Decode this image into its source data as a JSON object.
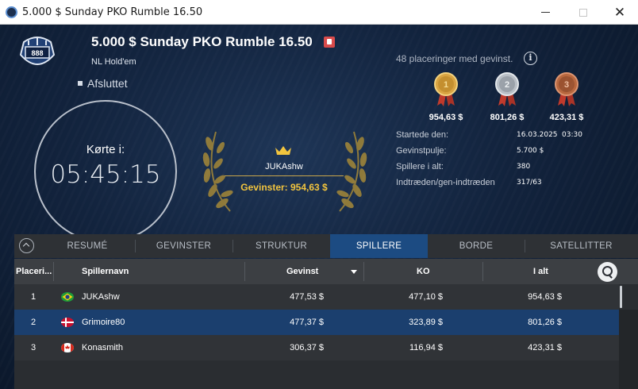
{
  "window": {
    "title": "5.000 $ Sunday PKO Rumble 16.50",
    "minimize_icon": "minimize-icon",
    "maximize_icon": "maximize-icon",
    "close_icon": "close-icon",
    "close_glyph": "✕"
  },
  "header": {
    "logo_text": "888",
    "tournament_title": "5.000 $ Sunday PKO Rumble 16.50",
    "game_type": "NL Hold'em",
    "status": "Afsluttet"
  },
  "clock": {
    "label": "Kørte i:",
    "time": "05:45:15"
  },
  "winner": {
    "name": "JUKAshw",
    "winnings": "Gevinster: 954,63 $"
  },
  "prizes": {
    "placements_text": "48 placeringer med gevinst.",
    "info_glyph": "i",
    "medals": [
      {
        "rank": "1",
        "amount": "954,63 $",
        "color": "#d9a441"
      },
      {
        "rank": "2",
        "amount": "801,26 $",
        "color": "#b9bfc6"
      },
      {
        "rank": "3",
        "amount": "423,31 $",
        "color": "#b8673e"
      }
    ]
  },
  "stats": {
    "started_label": "Startede den:",
    "started_date": "16.03.2025",
    "started_time": "03:30",
    "prizepool_label": "Gevinstpulje:",
    "prizepool_value": "5.700 $",
    "players_label": "Spillere i alt:",
    "players_value": "380",
    "entries_label": "Indtræden/gen-indtræden",
    "entries_value": "317/63"
  },
  "tabs": [
    {
      "label": "RESUMÉ"
    },
    {
      "label": "GEVINSTER"
    },
    {
      "label": "STRUKTUR"
    },
    {
      "label": "SPILLERE"
    },
    {
      "label": "BORDE"
    },
    {
      "label": "SATELLITTER"
    }
  ],
  "active_tab": "SPILLERE",
  "table": {
    "columns": {
      "place": "Placeri...",
      "name": "Spillernavn",
      "winnings": "Gevinst",
      "ko": "KO",
      "total": "I alt"
    },
    "rows": [
      {
        "place": "1",
        "country": "Brazil",
        "name": "JUKAshw",
        "winnings": "477,53 $",
        "ko": "477,10 $",
        "total": "954,63 $"
      },
      {
        "place": "2",
        "country": "Denmark",
        "name": "Grimoire80",
        "winnings": "477,37 $",
        "ko": "323,89 $",
        "total": "801,26 $"
      },
      {
        "place": "3",
        "country": "Canada",
        "name": "Konasmith",
        "winnings": "306,37 $",
        "ko": "116,94 $",
        "total": "423,31 $"
      }
    ]
  },
  "colors": {
    "accent": "#1c4b82",
    "gold_text": "#f2c43d",
    "background": "#12233d"
  }
}
